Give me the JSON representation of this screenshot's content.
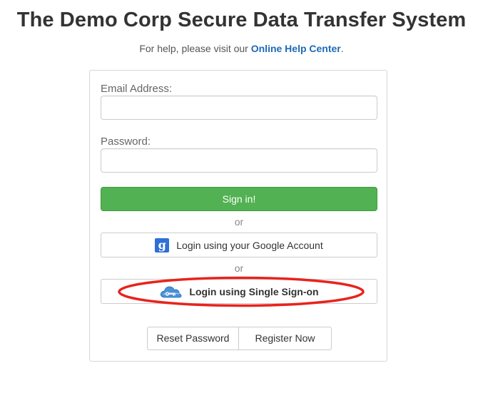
{
  "header": {
    "title": "The Demo Corp Secure Data Transfer System",
    "help_prefix": "For help, please visit our ",
    "help_link": "Online Help Center",
    "help_suffix": "."
  },
  "login_form": {
    "email_label": "Email Address:",
    "email_value": "",
    "email_placeholder": "",
    "password_label": "Password:",
    "password_value": "",
    "password_placeholder": "",
    "signin_label": "Sign in!",
    "or_1": "or",
    "google_label": "Login using your Google Account",
    "google_icon_glyph": "g",
    "or_2": "or",
    "sso_label": "Login using Single Sign-on",
    "reset_label": "Reset Password",
    "register_label": "Register Now"
  },
  "icons": {
    "google": "google-icon",
    "sso": "cloud-key-icon"
  },
  "colors": {
    "signin_green": "#52b152",
    "link_blue": "#1f6bb6",
    "highlight_red": "#e8231c",
    "google_blue": "#2f6fd6",
    "sso_cloud_blue": "#4a90d9"
  }
}
